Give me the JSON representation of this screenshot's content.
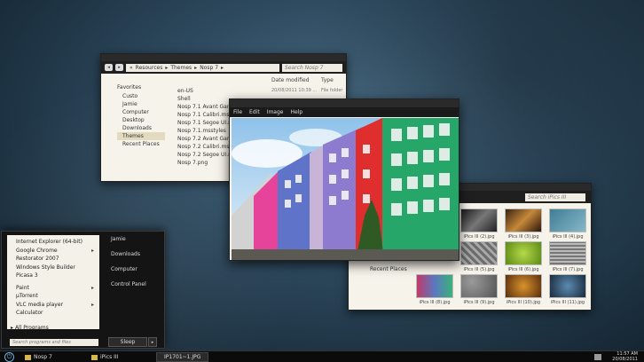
{
  "explorer": {
    "breadcrumb": [
      "Resources",
      "Themes",
      "Nosp 7"
    ],
    "search_placeholder": "Search Nosp 7",
    "nav_header": "Favorites",
    "nav_items": [
      "Custo",
      "Jamie",
      "Computer",
      "Desktop",
      "Downloads",
      "Themes",
      "Recent Places"
    ],
    "columns": [
      "Date modified",
      "Type"
    ],
    "files": [
      "en-US",
      "Shell",
      "Nosp 7.1 Avant Garde.m",
      "Nosp 7.1 Calibri.msstyle",
      "Nosp 7.1 Segoe UI.mssty",
      "Nosp 7.1.msstyles",
      "Nosp 7.2 Avant Garde.m",
      "Nosp 7.2 Calibri.msstyle",
      "Nosp 7.2 Segoe UI.mssty",
      "Nosp 7.png"
    ],
    "first_row_date": "20/08/2011 10:39 ...",
    "first_row_type": "File folder"
  },
  "viewer": {
    "menu": [
      "File",
      "Edit",
      "Image",
      "Help"
    ]
  },
  "pics": {
    "search_placeholder": "Search iPics III",
    "recent_places": "Recent Places",
    "thumbs": [
      "iPics III (2).jpg",
      "iPics III (3).jpg",
      "iPics III (4).jpg",
      "iPics III (5).jpg",
      "iPics III (6).jpg",
      "iPics III (7).jpg",
      "iPics III (8).jpg",
      "iPics III (9).jpg",
      "iPics III (10).jpg",
      "iPics III (11).jpg",
      "iPics III (12).jpg",
      "iPics III (13).jpg"
    ]
  },
  "start": {
    "programs_top": [
      "Internet Explorer (64-bit)",
      "Google Chrome",
      "Restorator 2007",
      "Windows Style Builder",
      "Picasa 3"
    ],
    "programs_bottom": [
      "Paint",
      "µTorrent",
      "VLC media player",
      "Calculator"
    ],
    "all_programs": "All Programs",
    "places": [
      "Jamie",
      "Downloads",
      "Computer",
      "Control Panel"
    ],
    "search_placeholder": "Search programs and files",
    "sleep": "Sleep"
  },
  "taskbar": {
    "items": [
      "Nosp 7",
      "iPics III",
      "IP1701~1.JPG"
    ],
    "time": "11:57 AM",
    "date": "20/08/2011"
  }
}
